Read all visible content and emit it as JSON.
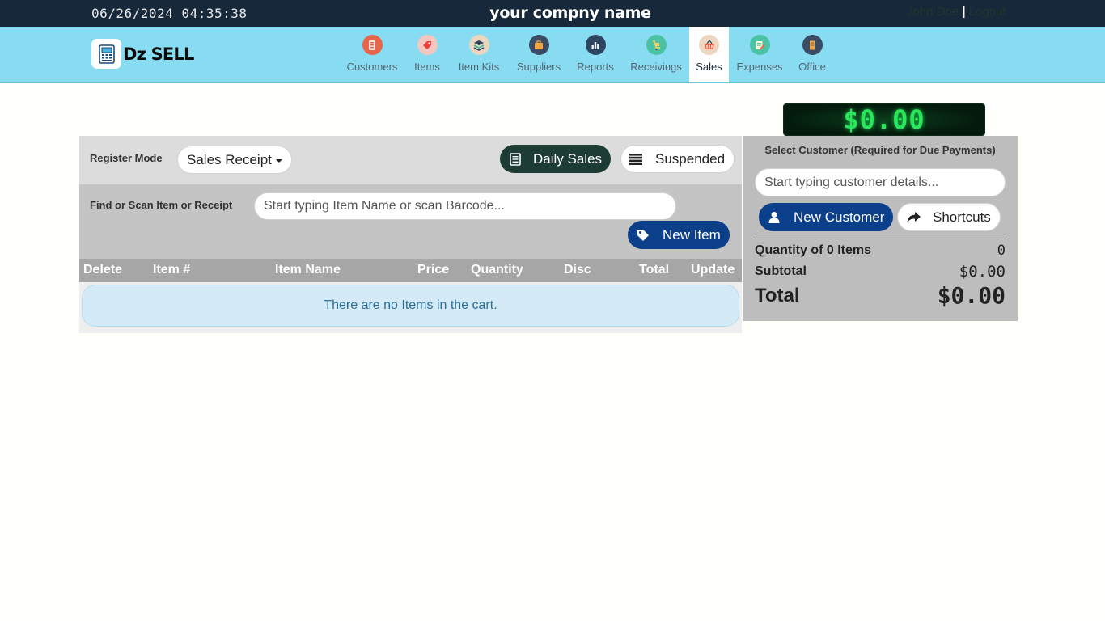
{
  "topbar": {
    "datetime": "06/26/2024 04:35:38",
    "company": "your compny name",
    "user": "John Doe",
    "separator": "|",
    "logout": "Logout"
  },
  "brand": {
    "name": "Dz SELL"
  },
  "nav": [
    {
      "label": "Customers",
      "icon": "customers-icon",
      "color": "#e8644a"
    },
    {
      "label": "Items",
      "icon": "items-tag-icon",
      "color": "#f1a7a0"
    },
    {
      "label": "Item Kits",
      "icon": "item-kits-icon",
      "color": "#ecd6c0"
    },
    {
      "label": "Suppliers",
      "icon": "suppliers-icon",
      "color": "#3a4b63"
    },
    {
      "label": "Reports",
      "icon": "reports-icon",
      "color": "#2e4560"
    },
    {
      "label": "Receivings",
      "icon": "receivings-icon",
      "color": "#4cc2a4"
    },
    {
      "label": "Sales",
      "icon": "sales-basket-icon",
      "color": "#ecd6c0",
      "active": true
    },
    {
      "label": "Expenses",
      "icon": "expenses-icon",
      "color": "#4cc2a4"
    },
    {
      "label": "Office",
      "icon": "office-icon",
      "color": "#3a4b63"
    }
  ],
  "display_total": "$0.00",
  "register": {
    "mode_label": "Register Mode",
    "mode_value": "Sales Receipt",
    "daily_sales": "Daily Sales",
    "suspended": "Suspended",
    "find_label": "Find or Scan Item or Receipt",
    "find_placeholder": "Start typing Item Name or scan Barcode...",
    "new_item": "New Item",
    "columns": [
      "Delete",
      "Item #",
      "Item Name",
      "Price",
      "Quantity",
      "Disc",
      "Total",
      "Update"
    ],
    "empty_message": "There are no Items in the cart."
  },
  "customer": {
    "title": "Select Customer (Required for Due Payments)",
    "placeholder": "Start typing customer details...",
    "new_customer": "New Customer",
    "shortcuts": "Shortcuts",
    "quantity_label": "Quantity of 0 Items",
    "quantity_value": "0",
    "subtotal_label": "Subtotal",
    "subtotal_value": "$0.00",
    "total_label": "Total",
    "total_value": "$0.00"
  },
  "colors": {
    "topbar": "#17283a",
    "navbar": "#87dcf1",
    "primary_blue": "#0b3f8a",
    "dark_green": "#1d3c34",
    "digital_green": "#29e65a"
  }
}
